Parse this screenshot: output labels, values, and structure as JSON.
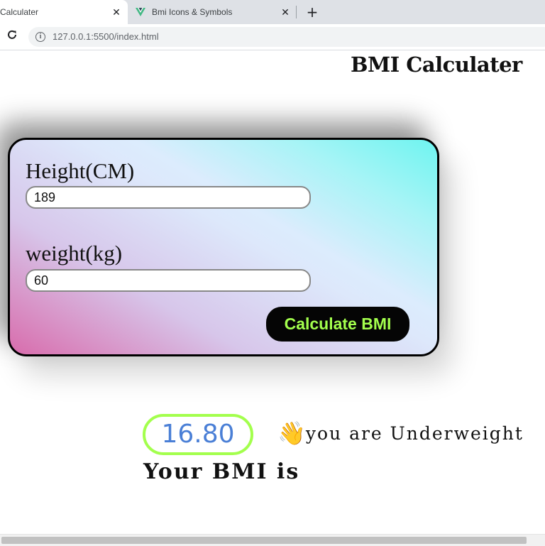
{
  "browser": {
    "tabs": [
      {
        "title": "Calculater",
        "close": "✕"
      },
      {
        "title": "Bmi Icons & Symbols",
        "close": "✕"
      }
    ],
    "new_tab": "+",
    "reload": "C",
    "info": "i",
    "url": "127.0.0.1:5500/index.html"
  },
  "page": {
    "title": "BMI Calculater",
    "height_label": "Height(CM)",
    "height_value": "189",
    "weight_label": "weight(kg)",
    "weight_value": "60",
    "calculate_label": "Calculate BMI",
    "bmi_value": "16.80",
    "status_emoji": "👋",
    "status_text": "you are Underweight",
    "bmi_caption": "Your BMI is"
  },
  "colors": {
    "accent": "#a3ff4d",
    "bmi_value": "#4a7fd6",
    "button_bg": "#050505"
  }
}
